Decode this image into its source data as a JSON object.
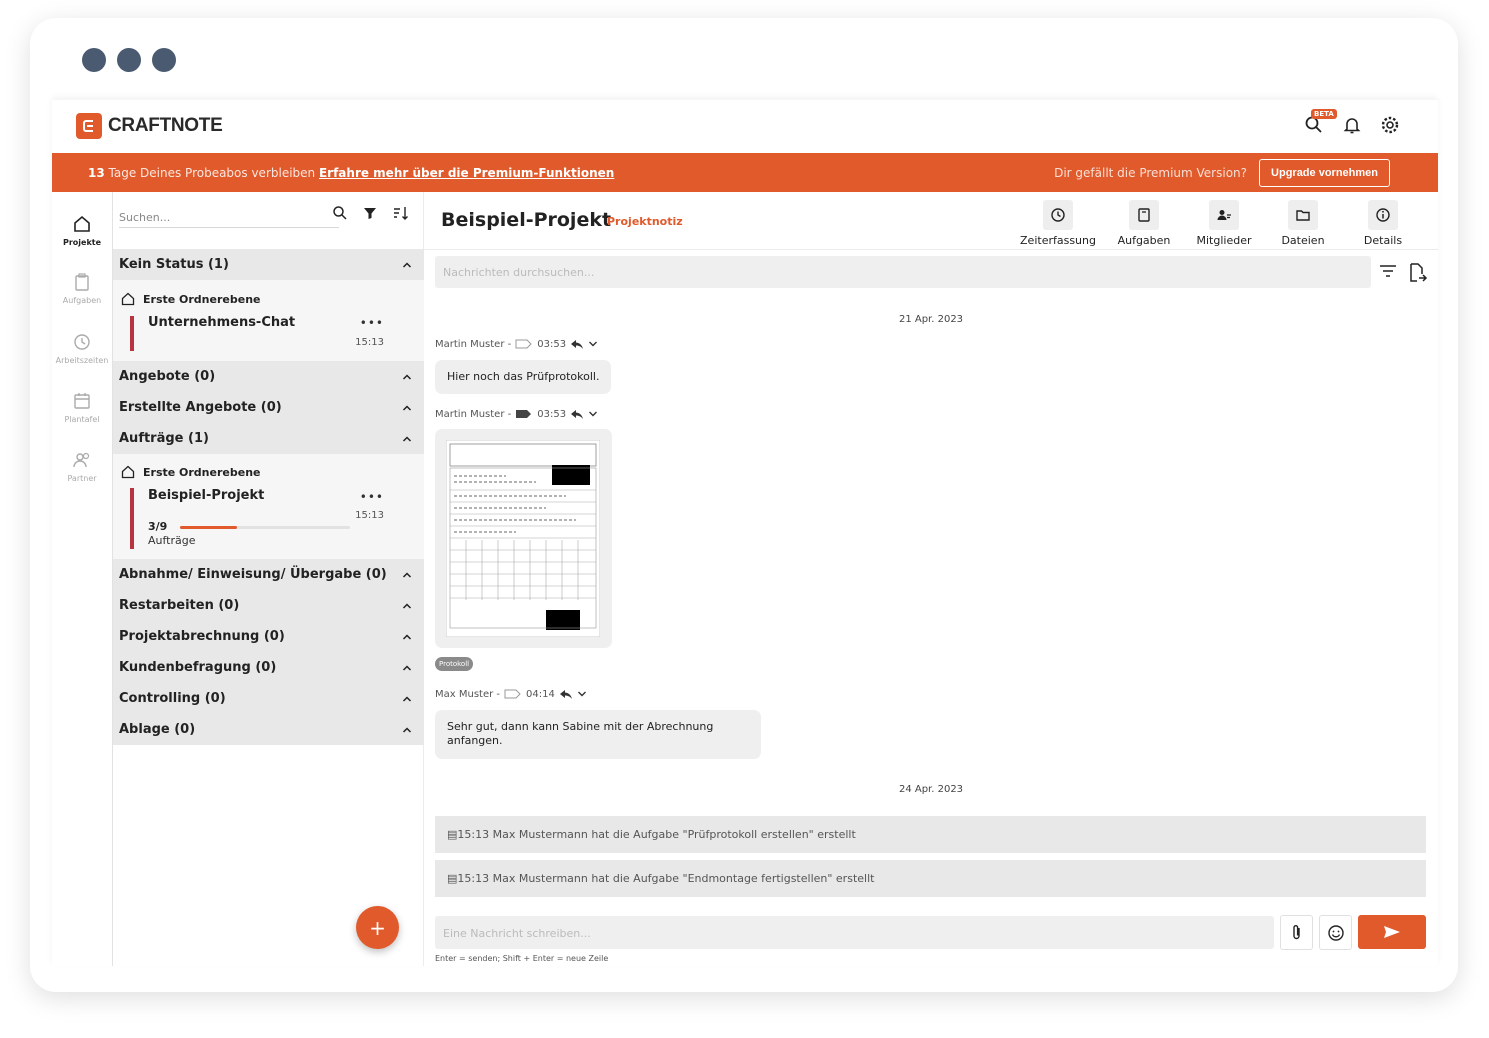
{
  "window": {
    "controls": [
      "dot-1",
      "dot-2",
      "dot-3"
    ]
  },
  "header": {
    "brand": "CRAFTNOTE",
    "beta_badge": "BETA",
    "icons": [
      "search-beta-icon",
      "bell-icon",
      "gear-icon"
    ]
  },
  "banner": {
    "days": "13",
    "trial_text": " Tage Deines Probeabos verbleiben ",
    "premium_link": "Erfahre mehr über die Premium-Funktionen",
    "question": "Dir gefällt die Premium Version?",
    "upgrade_label": "Upgrade vornehmen"
  },
  "rail": {
    "items": [
      {
        "label": "Projekte",
        "icon": "home-icon",
        "active": true
      },
      {
        "label": "Aufgaben",
        "icon": "clipboard-icon",
        "active": false
      },
      {
        "label": "Arbeitszeiten",
        "icon": "clock-icon",
        "active": false
      },
      {
        "label": "Plantafel",
        "icon": "calendar-icon",
        "active": false
      },
      {
        "label": "Partner",
        "icon": "people-icon",
        "active": false
      }
    ]
  },
  "project_list": {
    "search_placeholder": "Suchen...",
    "groups": [
      {
        "label": "Kein Status (1)"
      },
      {
        "label": "Angebote (0)"
      },
      {
        "label": "Erstellte Angebote (0)"
      },
      {
        "label": "Aufträge (1)"
      },
      {
        "label": "Abnahme/ Einweisung/ Übergabe (0)"
      },
      {
        "label": "Restarbeiten (0)"
      },
      {
        "label": "Projektabrechnung (0)"
      },
      {
        "label": "Kundenbefragung (0)"
      },
      {
        "label": "Controlling (0)"
      },
      {
        "label": "Ablage (0)"
      }
    ],
    "folder_label": "Erste Ordnerebene",
    "project_1": {
      "name": "Unternehmens-Chat",
      "more": "•••",
      "time": "15:13"
    },
    "project_2": {
      "name": "Beispiel-Projekt",
      "more": "•••",
      "time": "15:13",
      "progress_text": "3/9",
      "progress_fraction": 0.333,
      "progress_label": "Aufträge"
    },
    "fab_label": "+"
  },
  "chat": {
    "title": "Beispiel-Projekt",
    "subtitle": "Projektnotiz",
    "tools": [
      {
        "label": "Zeiterfassung",
        "icon": "clock-icon"
      },
      {
        "label": "Aufgaben",
        "icon": "clipboard-icon"
      },
      {
        "label": "Mitglieder",
        "icon": "members-icon"
      },
      {
        "label": "Dateien",
        "icon": "folder-icon"
      },
      {
        "label": "Details",
        "icon": "info-icon"
      }
    ],
    "search_placeholder": "Nachrichten durchsuchen...",
    "date_1": "21 Apr. 2023",
    "msg_1": {
      "author": "Martin Muster - ",
      "time": "03:53",
      "text": "Hier noch das Prüfprotokoll."
    },
    "msg_2": {
      "author": "Martin Muster - ",
      "time": "03:53",
      "tag": "Protokoll"
    },
    "msg_3": {
      "author": "Max Muster - ",
      "time": "04:14",
      "text": "Sehr gut, dann kann Sabine mit der Abrechnung anfangen."
    },
    "date_2": "24 Apr. 2023",
    "system_1": "15:13 Max Mustermann hat die Aufgabe \"Prüfprotokoll erstellen\" erstellt",
    "system_2": "15:13 Max Mustermann hat die Aufgabe \"Endmontage fertigstellen\" erstellt",
    "composer_placeholder": "Eine Nachricht schreiben...",
    "hint": "Enter = senden; Shift + Enter = neue Zeile"
  }
}
